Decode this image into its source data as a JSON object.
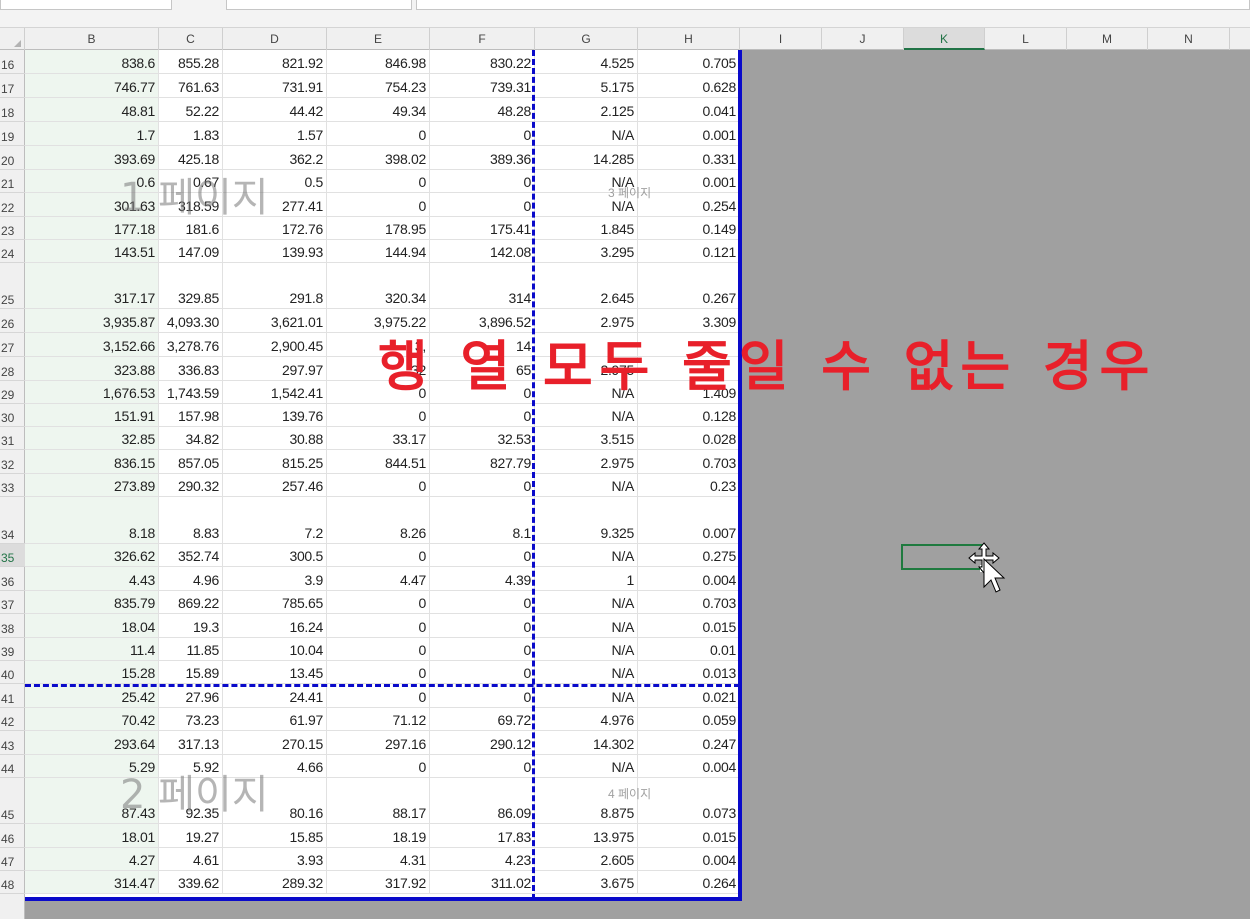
{
  "columns": [
    "B",
    "C",
    "D",
    "E",
    "F",
    "G",
    "H",
    "I",
    "J",
    "K",
    "L",
    "M",
    "N"
  ],
  "selected_column": "K",
  "selected_row": "35",
  "rows": [
    {
      "n": "16",
      "v": [
        "838.6",
        "855.28",
        "821.92",
        "846.98",
        "830.22",
        "4.525",
        "0.705"
      ]
    },
    {
      "n": "17",
      "v": [
        "746.77",
        "761.63",
        "731.91",
        "754.23",
        "739.31",
        "5.175",
        "0.628"
      ]
    },
    {
      "n": "18",
      "v": [
        "48.81",
        "52.22",
        "44.42",
        "49.34",
        "48.28",
        "2.125",
        "0.041"
      ]
    },
    {
      "n": "19",
      "v": [
        "1.7",
        "1.83",
        "1.57",
        "0",
        "0",
        "N/A",
        "0.001"
      ]
    },
    {
      "n": "20",
      "v": [
        "393.69",
        "425.18",
        "362.2",
        "398.02",
        "389.36",
        "14.285",
        "0.331"
      ]
    },
    {
      "n": "21",
      "v": [
        "0.6",
        "0.67",
        "0.5",
        "0",
        "0",
        "N/A",
        "0.001"
      ]
    },
    {
      "n": "22",
      "v": [
        "301.63",
        "318.59",
        "277.41",
        "0",
        "0",
        "N/A",
        "0.254"
      ]
    },
    {
      "n": "23",
      "v": [
        "177.18",
        "181.6",
        "172.76",
        "178.95",
        "175.41",
        "1.845",
        "0.149"
      ]
    },
    {
      "n": "24",
      "v": [
        "143.51",
        "147.09",
        "139.93",
        "144.94",
        "142.08",
        "3.295",
        "0.121"
      ]
    },
    {
      "n": "25",
      "v": [
        "317.17",
        "329.85",
        "291.8",
        "320.34",
        "314",
        "2.645",
        "0.267"
      ]
    },
    {
      "n": "26",
      "v": [
        "3,935.87",
        "4,093.30",
        "3,621.01",
        "3,975.22",
        "3,896.52",
        "2.975",
        "3.309"
      ]
    },
    {
      "n": "27",
      "v": [
        "3,152.66",
        "3,278.76",
        "2,900.45",
        "3,",
        "14",
        "",
        ""
      ]
    },
    {
      "n": "28",
      "v": [
        "323.88",
        "336.83",
        "297.97",
        "32",
        "65",
        "2.975",
        ""
      ]
    },
    {
      "n": "29",
      "v": [
        "1,676.53",
        "1,743.59",
        "1,542.41",
        "0",
        "0",
        "N/A",
        "1.409"
      ]
    },
    {
      "n": "30",
      "v": [
        "151.91",
        "157.98",
        "139.76",
        "0",
        "0",
        "N/A",
        "0.128"
      ]
    },
    {
      "n": "31",
      "v": [
        "32.85",
        "34.82",
        "30.88",
        "33.17",
        "32.53",
        "3.515",
        "0.028"
      ]
    },
    {
      "n": "32",
      "v": [
        "836.15",
        "857.05",
        "815.25",
        "844.51",
        "827.79",
        "2.975",
        "0.703"
      ]
    },
    {
      "n": "33",
      "v": [
        "273.89",
        "290.32",
        "257.46",
        "0",
        "0",
        "N/A",
        "0.23"
      ]
    },
    {
      "n": "34",
      "v": [
        "8.18",
        "8.83",
        "7.2",
        "8.26",
        "8.1",
        "9.325",
        "0.007"
      ]
    },
    {
      "n": "35",
      "v": [
        "326.62",
        "352.74",
        "300.5",
        "0",
        "0",
        "N/A",
        "0.275"
      ]
    },
    {
      "n": "36",
      "v": [
        "4.43",
        "4.96",
        "3.9",
        "4.47",
        "4.39",
        "1",
        "0.004"
      ]
    },
    {
      "n": "37",
      "v": [
        "835.79",
        "869.22",
        "785.65",
        "0",
        "0",
        "N/A",
        "0.703"
      ]
    },
    {
      "n": "38",
      "v": [
        "18.04",
        "19.3",
        "16.24",
        "0",
        "0",
        "N/A",
        "0.015"
      ]
    },
    {
      "n": "39",
      "v": [
        "11.4",
        "11.85",
        "10.04",
        "0",
        "0",
        "N/A",
        "0.01"
      ]
    },
    {
      "n": "40",
      "v": [
        "15.28",
        "15.89",
        "13.45",
        "0",
        "0",
        "N/A",
        "0.013"
      ]
    },
    {
      "n": "41",
      "v": [
        "25.42",
        "27.96",
        "24.41",
        "0",
        "0",
        "N/A",
        "0.021"
      ]
    },
    {
      "n": "42",
      "v": [
        "70.42",
        "73.23",
        "61.97",
        "71.12",
        "69.72",
        "4.976",
        "0.059"
      ]
    },
    {
      "n": "43",
      "v": [
        "293.64",
        "317.13",
        "270.15",
        "297.16",
        "290.12",
        "14.302",
        "0.247"
      ]
    },
    {
      "n": "44",
      "v": [
        "5.29",
        "5.92",
        "4.66",
        "0",
        "0",
        "N/A",
        "0.004"
      ]
    },
    {
      "n": "45",
      "v": [
        "87.43",
        "92.35",
        "80.16",
        "88.17",
        "86.09",
        "8.875",
        "0.073"
      ]
    },
    {
      "n": "46",
      "v": [
        "18.01",
        "19.27",
        "15.85",
        "18.19",
        "17.83",
        "13.975",
        "0.015"
      ]
    },
    {
      "n": "47",
      "v": [
        "4.27",
        "4.61",
        "3.93",
        "4.31",
        "4.23",
        "2.605",
        "0.004"
      ]
    },
    {
      "n": "48",
      "v": [
        "314.47",
        "339.62",
        "289.32",
        "317.92",
        "311.02",
        "3.675",
        "0.264"
      ]
    }
  ],
  "watermarks": {
    "page1": "1 페이지",
    "page2": "2 페이지",
    "page3": "3 페이지",
    "page4": "4 페이지"
  },
  "banner_text": "행 열 모두 줄일 수 없는 경우",
  "colors": {
    "page_break": "#0a0aca",
    "banner": "#e8202a",
    "selection": "#1f7a3f",
    "outside_print_area": "#a0a0a0"
  }
}
